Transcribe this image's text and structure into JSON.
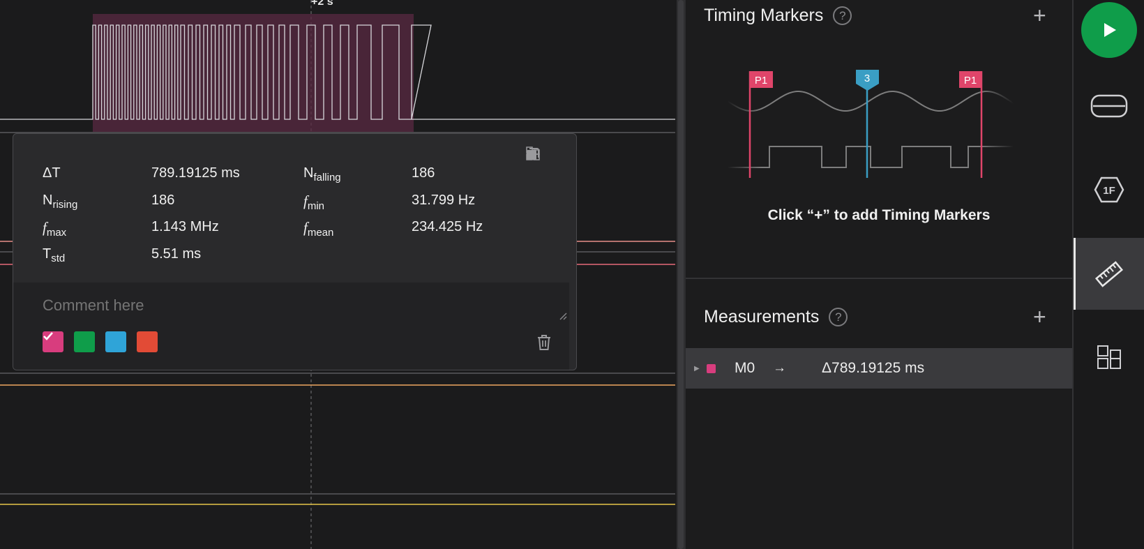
{
  "waveform": {
    "time_label": "+2 s"
  },
  "popover": {
    "stats": {
      "delta_t_label": "ΔT",
      "delta_t_value": "789.19125 ms",
      "n_falling_label": "N",
      "n_falling_sub": "falling",
      "n_falling_value": "186",
      "n_rising_label": "N",
      "n_rising_sub": "rising",
      "n_rising_value": "186",
      "f_min_label": "f",
      "f_min_sub": "min",
      "f_min_value": "31.799 Hz",
      "f_max_label": "f",
      "f_max_sub": "max",
      "f_max_value": "1.143 MHz",
      "f_mean_label": "f",
      "f_mean_sub": "mean",
      "f_mean_value": "234.425 Hz",
      "t_std_label": "T",
      "t_std_sub": "std",
      "t_std_value": "5.51 ms"
    },
    "comment_placeholder": "Comment here",
    "swatch_colors": [
      "#d83d7e",
      "#0f9d4a",
      "#2fa4d8",
      "#e24b36"
    ],
    "selected_swatch": "#d83d7e"
  },
  "timing_markers": {
    "title": "Timing Markers",
    "help": "?",
    "add": "+",
    "illustration": {
      "marker_left": "P1",
      "marker_center": "3",
      "marker_right": "P1"
    },
    "hint": "Click “+” to add Timing Markers"
  },
  "measurements": {
    "title": "Measurements",
    "help": "?",
    "add": "+",
    "rows": [
      {
        "name": "M0",
        "arrow": "→",
        "value": "Δ789.19125 ms",
        "color": "#d83d7e"
      }
    ]
  },
  "rail": {
    "play_icon": "play-icon",
    "items": [
      "device-icon",
      "analyzer-icon",
      "measure-icon",
      "extensions-icon"
    ],
    "analyzer_label": "1F",
    "active": "measure-icon"
  }
}
